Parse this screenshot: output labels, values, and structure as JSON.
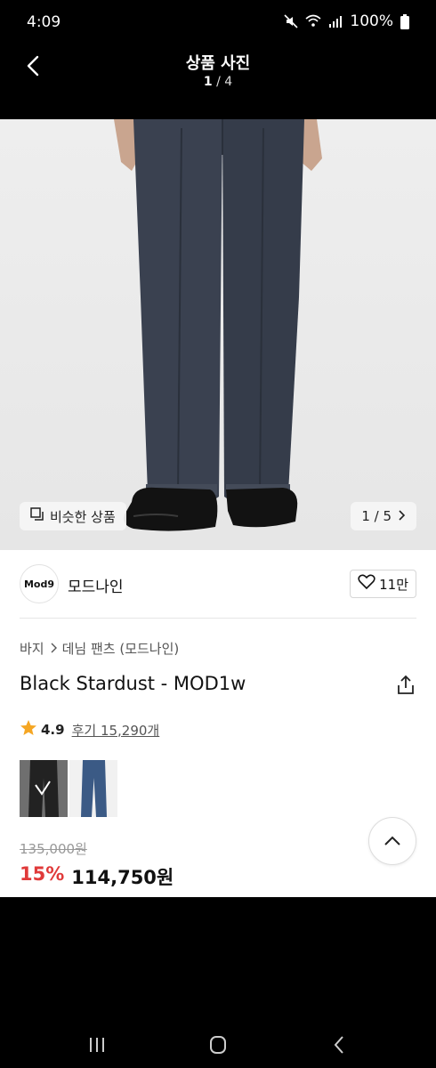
{
  "status_bar": {
    "time": "4:09",
    "battery": "100%",
    "icons": [
      "mute-icon",
      "wifi-icon",
      "signal-icon",
      "battery-icon"
    ]
  },
  "header": {
    "title": "상품 사진",
    "counter_current": "1",
    "counter_total": "/ 4"
  },
  "photo": {
    "similar_label": "비슷한 상품",
    "pager": "1 / 5"
  },
  "brand": {
    "logo_text": "Mod9",
    "name": "모드나인",
    "likes": "11만"
  },
  "breadcrumb": [
    "바지",
    "데님 팬츠 (모드나인)"
  ],
  "product": {
    "title": "Black Stardust - MOD1w",
    "rating": "4.9",
    "reviews": "후기 15,290개",
    "original_price": "135,000원",
    "discount": "15%",
    "sale_price": "114,750원"
  },
  "colors": {
    "accent_red": "#e03a3a",
    "star": "#f5a623"
  }
}
